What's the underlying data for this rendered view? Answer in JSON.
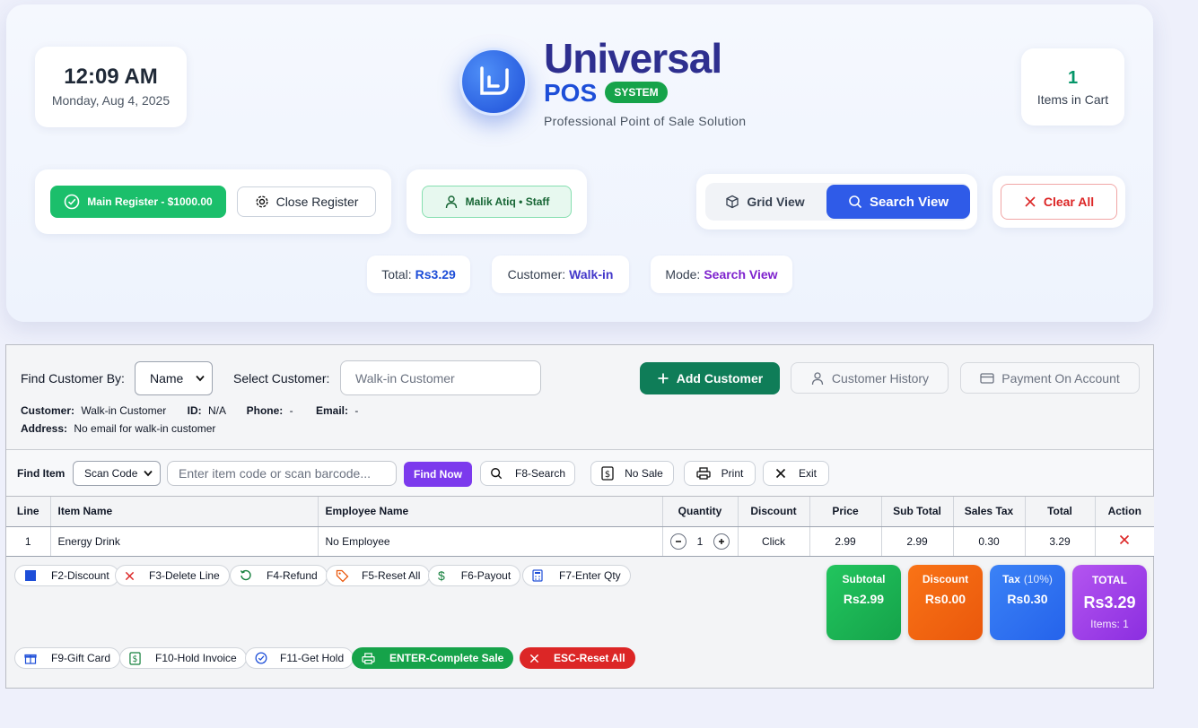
{
  "header": {
    "clock": {
      "time": "12:09 AM",
      "date": "Monday, Aug 4, 2025"
    },
    "brand": {
      "title": "Universal",
      "pos": "POS",
      "badge": "SYSTEM",
      "subtitle": "Professional Point of Sale Solution"
    },
    "cart": {
      "count": "1",
      "label": "Items in Cart"
    },
    "register": {
      "main_label": "Main Register - $1000.00",
      "close_label": "Close Register"
    },
    "staff": {
      "label": "Malik Atiq • Staff"
    },
    "view": {
      "grid_label": "Grid View",
      "search_label": "Search View",
      "active": "Search View"
    },
    "clear_label": "Clear All",
    "status": {
      "total_label": "Total:",
      "total_value": "Rs3.29",
      "customer_label": "Customer:",
      "customer_value": "Walk-in",
      "mode_label": "Mode:",
      "mode_value": "Search View"
    }
  },
  "customer": {
    "find_by_label": "Find Customer By:",
    "find_by_value": "Name",
    "select_label": "Select Customer:",
    "select_placeholder": "Walk-in Customer",
    "add_label": "Add Customer",
    "history_label": "Customer History",
    "payment_label": "Payment On Account",
    "info": {
      "customer_label": "Customer:",
      "customer_value": "Walk-in Customer",
      "id_label": "ID:",
      "id_value": "N/A",
      "phone_label": "Phone:",
      "phone_value": "-",
      "email_label": "Email:",
      "email_value": "-",
      "address_label": "Address:",
      "address_value": "No email for walk-in customer"
    }
  },
  "find_item": {
    "label": "Find Item",
    "mode_value": "Scan Code",
    "placeholder": "Enter item code or scan barcode...",
    "find_now": "Find Now",
    "f8_search": "F8-Search",
    "no_sale": "No Sale",
    "print": "Print",
    "exit": "Exit"
  },
  "table": {
    "headers": [
      "Line",
      "Item Name",
      "Employee Name",
      "Quantity",
      "Discount",
      "Price",
      "Sub Total",
      "Sales Tax",
      "Total",
      "Action"
    ],
    "rows": [
      {
        "line": "1",
        "item": "Energy Drink",
        "employee": "No Employee",
        "qty": "1",
        "discount": "Click",
        "price": "2.99",
        "subtotal": "2.99",
        "tax": "0.30",
        "total": "3.29"
      }
    ]
  },
  "fkeys": {
    "f2": "F2-Discount",
    "f3": "F3-Delete Line",
    "f4": "F4-Refund",
    "f5": "F5-Reset All",
    "f6": "F6-Payout",
    "f7": "F7-Enter Qty",
    "f9": "F9-Gift Card",
    "f10": "F10-Hold Invoice",
    "f11": "F11-Get Hold",
    "enter": "ENTER-Complete Sale",
    "esc": "ESC-Reset All"
  },
  "summary": {
    "subtotal_label": "Subtotal",
    "subtotal_value": "Rs2.99",
    "discount_label": "Discount",
    "discount_value": "Rs0.00",
    "tax_label": "Tax",
    "tax_pct": "(10%)",
    "tax_value": "Rs0.30",
    "total_label": "TOTAL",
    "total_value": "Rs3.29",
    "items": "Items: 1"
  },
  "colors": {
    "accent": "#2f5be8",
    "success": "#16a34a",
    "danger": "#dc2626",
    "purple": "#7c3aed",
    "brand": "#2e2f8f"
  },
  "icons": [
    "check-circle-icon",
    "gear-icon",
    "user-icon",
    "box-icon",
    "search-icon",
    "close-icon",
    "plus-icon",
    "card-icon",
    "dollar-icon",
    "printer-icon",
    "gift-icon",
    "refresh-icon",
    "tag-icon",
    "calculator-icon",
    "square-icon"
  ]
}
